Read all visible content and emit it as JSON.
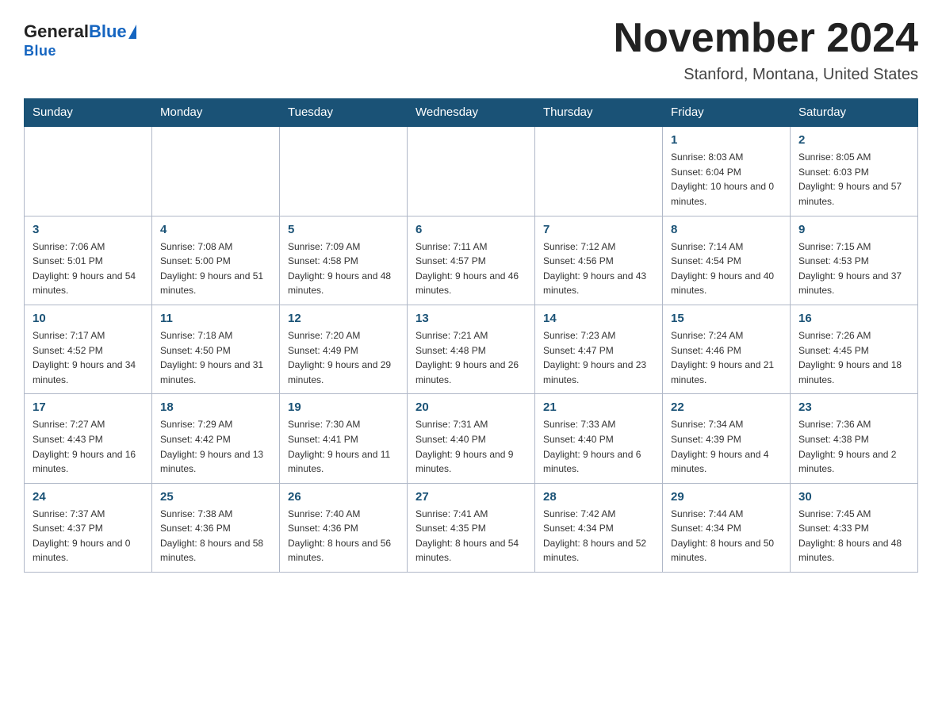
{
  "header": {
    "logo_general": "General",
    "logo_blue": "Blue",
    "title": "November 2024",
    "subtitle": "Stanford, Montana, United States"
  },
  "days_of_week": [
    "Sunday",
    "Monday",
    "Tuesday",
    "Wednesday",
    "Thursday",
    "Friday",
    "Saturday"
  ],
  "weeks": [
    [
      {
        "day": "",
        "sunrise": "",
        "sunset": "",
        "daylight": ""
      },
      {
        "day": "",
        "sunrise": "",
        "sunset": "",
        "daylight": ""
      },
      {
        "day": "",
        "sunrise": "",
        "sunset": "",
        "daylight": ""
      },
      {
        "day": "",
        "sunrise": "",
        "sunset": "",
        "daylight": ""
      },
      {
        "day": "",
        "sunrise": "",
        "sunset": "",
        "daylight": ""
      },
      {
        "day": "1",
        "sunrise": "Sunrise: 8:03 AM",
        "sunset": "Sunset: 6:04 PM",
        "daylight": "Daylight: 10 hours and 0 minutes."
      },
      {
        "day": "2",
        "sunrise": "Sunrise: 8:05 AM",
        "sunset": "Sunset: 6:03 PM",
        "daylight": "Daylight: 9 hours and 57 minutes."
      }
    ],
    [
      {
        "day": "3",
        "sunrise": "Sunrise: 7:06 AM",
        "sunset": "Sunset: 5:01 PM",
        "daylight": "Daylight: 9 hours and 54 minutes."
      },
      {
        "day": "4",
        "sunrise": "Sunrise: 7:08 AM",
        "sunset": "Sunset: 5:00 PM",
        "daylight": "Daylight: 9 hours and 51 minutes."
      },
      {
        "day": "5",
        "sunrise": "Sunrise: 7:09 AM",
        "sunset": "Sunset: 4:58 PM",
        "daylight": "Daylight: 9 hours and 48 minutes."
      },
      {
        "day": "6",
        "sunrise": "Sunrise: 7:11 AM",
        "sunset": "Sunset: 4:57 PM",
        "daylight": "Daylight: 9 hours and 46 minutes."
      },
      {
        "day": "7",
        "sunrise": "Sunrise: 7:12 AM",
        "sunset": "Sunset: 4:56 PM",
        "daylight": "Daylight: 9 hours and 43 minutes."
      },
      {
        "day": "8",
        "sunrise": "Sunrise: 7:14 AM",
        "sunset": "Sunset: 4:54 PM",
        "daylight": "Daylight: 9 hours and 40 minutes."
      },
      {
        "day": "9",
        "sunrise": "Sunrise: 7:15 AM",
        "sunset": "Sunset: 4:53 PM",
        "daylight": "Daylight: 9 hours and 37 minutes."
      }
    ],
    [
      {
        "day": "10",
        "sunrise": "Sunrise: 7:17 AM",
        "sunset": "Sunset: 4:52 PM",
        "daylight": "Daylight: 9 hours and 34 minutes."
      },
      {
        "day": "11",
        "sunrise": "Sunrise: 7:18 AM",
        "sunset": "Sunset: 4:50 PM",
        "daylight": "Daylight: 9 hours and 31 minutes."
      },
      {
        "day": "12",
        "sunrise": "Sunrise: 7:20 AM",
        "sunset": "Sunset: 4:49 PM",
        "daylight": "Daylight: 9 hours and 29 minutes."
      },
      {
        "day": "13",
        "sunrise": "Sunrise: 7:21 AM",
        "sunset": "Sunset: 4:48 PM",
        "daylight": "Daylight: 9 hours and 26 minutes."
      },
      {
        "day": "14",
        "sunrise": "Sunrise: 7:23 AM",
        "sunset": "Sunset: 4:47 PM",
        "daylight": "Daylight: 9 hours and 23 minutes."
      },
      {
        "day": "15",
        "sunrise": "Sunrise: 7:24 AM",
        "sunset": "Sunset: 4:46 PM",
        "daylight": "Daylight: 9 hours and 21 minutes."
      },
      {
        "day": "16",
        "sunrise": "Sunrise: 7:26 AM",
        "sunset": "Sunset: 4:45 PM",
        "daylight": "Daylight: 9 hours and 18 minutes."
      }
    ],
    [
      {
        "day": "17",
        "sunrise": "Sunrise: 7:27 AM",
        "sunset": "Sunset: 4:43 PM",
        "daylight": "Daylight: 9 hours and 16 minutes."
      },
      {
        "day": "18",
        "sunrise": "Sunrise: 7:29 AM",
        "sunset": "Sunset: 4:42 PM",
        "daylight": "Daylight: 9 hours and 13 minutes."
      },
      {
        "day": "19",
        "sunrise": "Sunrise: 7:30 AM",
        "sunset": "Sunset: 4:41 PM",
        "daylight": "Daylight: 9 hours and 11 minutes."
      },
      {
        "day": "20",
        "sunrise": "Sunrise: 7:31 AM",
        "sunset": "Sunset: 4:40 PM",
        "daylight": "Daylight: 9 hours and 9 minutes."
      },
      {
        "day": "21",
        "sunrise": "Sunrise: 7:33 AM",
        "sunset": "Sunset: 4:40 PM",
        "daylight": "Daylight: 9 hours and 6 minutes."
      },
      {
        "day": "22",
        "sunrise": "Sunrise: 7:34 AM",
        "sunset": "Sunset: 4:39 PM",
        "daylight": "Daylight: 9 hours and 4 minutes."
      },
      {
        "day": "23",
        "sunrise": "Sunrise: 7:36 AM",
        "sunset": "Sunset: 4:38 PM",
        "daylight": "Daylight: 9 hours and 2 minutes."
      }
    ],
    [
      {
        "day": "24",
        "sunrise": "Sunrise: 7:37 AM",
        "sunset": "Sunset: 4:37 PM",
        "daylight": "Daylight: 9 hours and 0 minutes."
      },
      {
        "day": "25",
        "sunrise": "Sunrise: 7:38 AM",
        "sunset": "Sunset: 4:36 PM",
        "daylight": "Daylight: 8 hours and 58 minutes."
      },
      {
        "day": "26",
        "sunrise": "Sunrise: 7:40 AM",
        "sunset": "Sunset: 4:36 PM",
        "daylight": "Daylight: 8 hours and 56 minutes."
      },
      {
        "day": "27",
        "sunrise": "Sunrise: 7:41 AM",
        "sunset": "Sunset: 4:35 PM",
        "daylight": "Daylight: 8 hours and 54 minutes."
      },
      {
        "day": "28",
        "sunrise": "Sunrise: 7:42 AM",
        "sunset": "Sunset: 4:34 PM",
        "daylight": "Daylight: 8 hours and 52 minutes."
      },
      {
        "day": "29",
        "sunrise": "Sunrise: 7:44 AM",
        "sunset": "Sunset: 4:34 PM",
        "daylight": "Daylight: 8 hours and 50 minutes."
      },
      {
        "day": "30",
        "sunrise": "Sunrise: 7:45 AM",
        "sunset": "Sunset: 4:33 PM",
        "daylight": "Daylight: 8 hours and 48 minutes."
      }
    ]
  ]
}
